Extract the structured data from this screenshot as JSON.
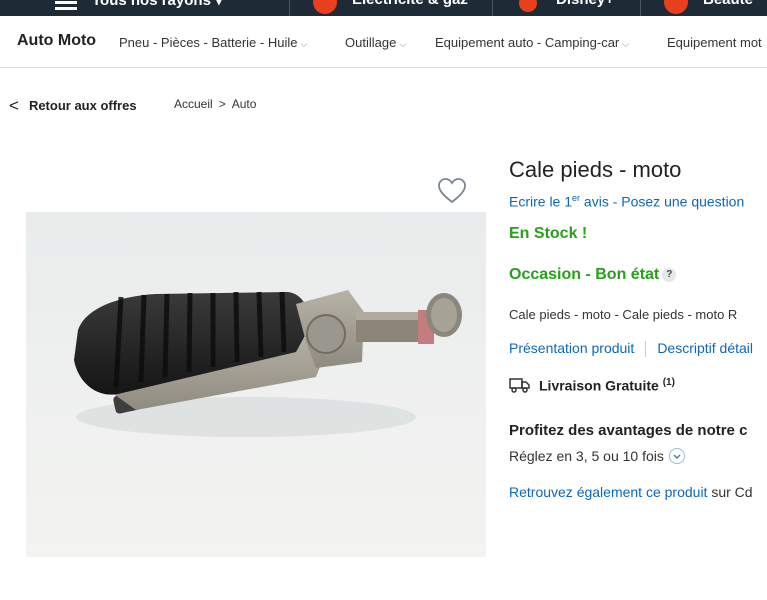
{
  "topbar": {
    "menu_label": "Tous nos rayons",
    "menu_chevron": "▾",
    "items": [
      {
        "label": "Electricité & gaz",
        "icon": "energy-logo-icon",
        "color": "#e8401c"
      },
      {
        "label": "Disney+",
        "icon": "disney-logo-icon",
        "color": "#e8401c"
      },
      {
        "label": "Beauté",
        "icon": "beauty-logo-icon",
        "color": "#e8401c"
      }
    ]
  },
  "catnav": {
    "brand": "Auto Moto",
    "categories": [
      "Pneu - Pièces - Batterie - Huile",
      "Outillage",
      "Equipement auto - Camping-car",
      "Equipement mot"
    ],
    "chevron": "⌵"
  },
  "breadcrumb": {
    "back_label": "Retour aux offres",
    "back_glyph": "<",
    "items": [
      "Accueil",
      "Auto"
    ],
    "separator": ">"
  },
  "product": {
    "title": "Cale pieds - moto",
    "review_prefix": "Ecrire le 1",
    "review_sup": "er",
    "review_suffix": " avis - Posez une question",
    "stock": "En Stock !",
    "condition": "Occasion - Bon état",
    "condition_help": "?",
    "short_description": "Cale pieds - moto - Cale pieds - moto R",
    "link_presentation": "Présentation produit",
    "link_details": "Descriptif détail",
    "delivery_label": "Livraison Gratuite",
    "delivery_note": "(1)",
    "promo_title": "Profitez des avantages de notre c",
    "installments": "Réglez en 3, 5 ou 10 fois",
    "also_link": "Retrouvez également ce produit",
    "also_suffix": " sur Cd"
  },
  "colors": {
    "accent_link": "#0d67b8",
    "in_stock": "#27a01b",
    "topbar_bg": "#1f2a37"
  }
}
